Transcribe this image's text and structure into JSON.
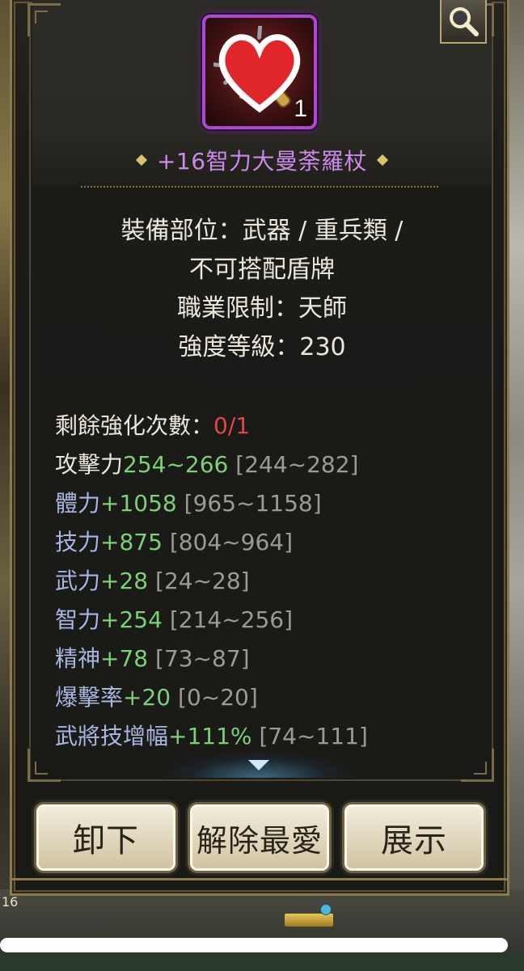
{
  "item": {
    "count": "1",
    "name": "+16智力大曼荼羅杖",
    "rarity_color": "#c98ae8"
  },
  "info": {
    "slot_line1": "裝備部位：武器 / 重兵類 /",
    "slot_line2": "不可搭配盾牌",
    "job_limit": "職業限制：天師",
    "strength_level": "強度等級：230"
  },
  "stats": {
    "remaining_label": "剩餘強化次數：",
    "remaining_value": "0/1",
    "rows": [
      {
        "label": "攻擊力",
        "value": "254~266",
        "range": "[244~282]"
      },
      {
        "label": "體力",
        "value": "+1058",
        "range": "[965~1158]"
      },
      {
        "label": "技力",
        "value": "+875",
        "range": "[804~964]"
      },
      {
        "label": "武力",
        "value": "+28",
        "range": "[24~28]"
      },
      {
        "label": "智力",
        "value": "+254",
        "range": "[214~256]"
      },
      {
        "label": "精神",
        "value": "+78",
        "range": "[73~87]"
      },
      {
        "label": "爆擊率",
        "value": "+20",
        "range": "[0~20]"
      },
      {
        "label": "武將技增幅",
        "value": "+111%",
        "range": "[74~111]"
      }
    ]
  },
  "buttons": {
    "unequip": "卸下",
    "unfavorite": "解除最愛",
    "show": "展示"
  },
  "background": {
    "level_number": "16"
  },
  "icons": {
    "magnify": "magnify-icon",
    "heart": "heart-icon",
    "scroll_down": "chevron-down-icon"
  }
}
